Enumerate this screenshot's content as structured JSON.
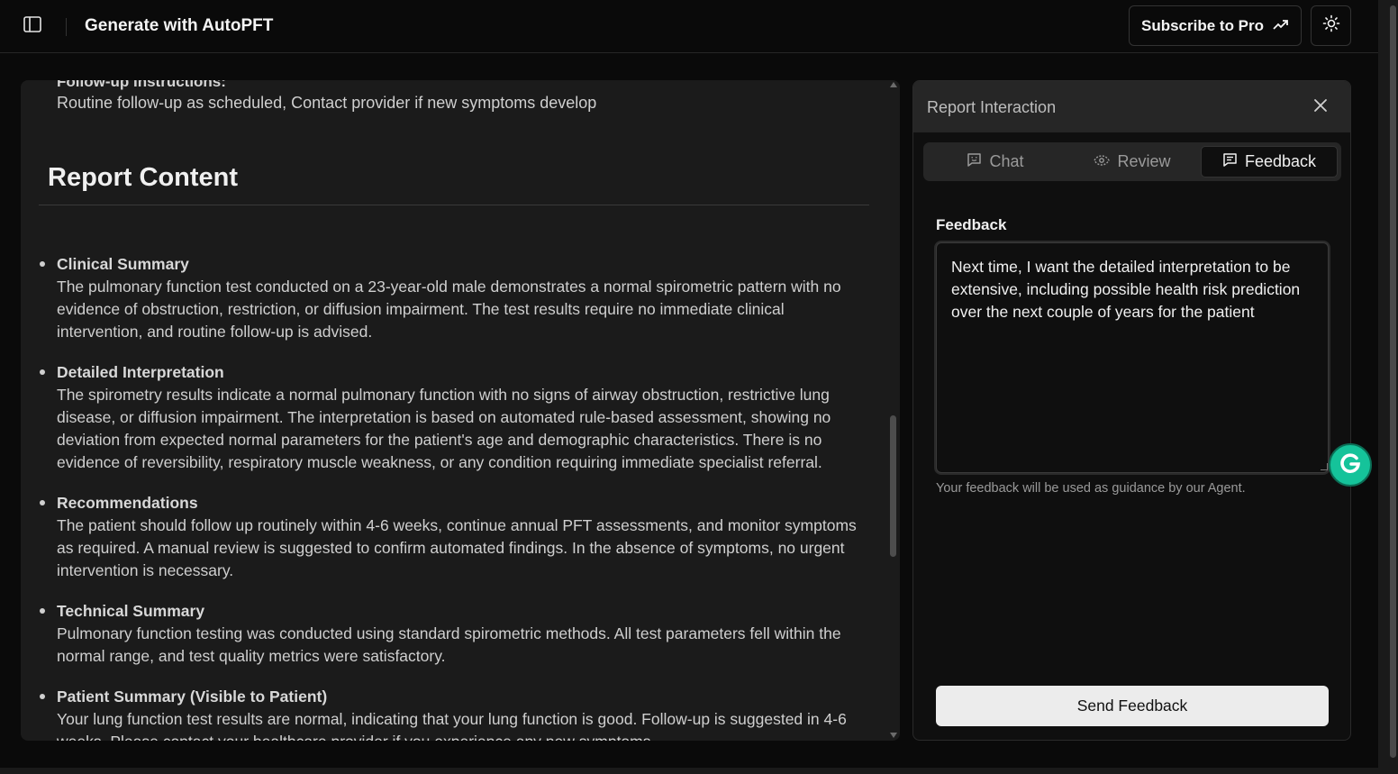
{
  "header": {
    "title": "Generate with AutoPFT",
    "subscribe_label": "Subscribe to Pro"
  },
  "icons": {
    "sidebar_toggle": "sidebar-panel-icon",
    "subscribe": "trending-up-arrow-icon",
    "theme": "sun-icon",
    "close": "close-icon",
    "chat": "message-square-icon",
    "review": "eye-scan-icon",
    "feedback": "message-square-text-icon",
    "grammarly": "grammarly-g-icon"
  },
  "report": {
    "followup_label": "Follow-up Instructions:",
    "followup_text": "Routine follow-up as scheduled, Contact provider if new symptoms develop",
    "heading": "Report Content",
    "sections": [
      {
        "title": "Clinical Summary",
        "body": "The pulmonary function test conducted on a 23-year-old male demonstrates a normal spirometric pattern with no evidence of obstruction, restriction, or diffusion impairment. The test results require no immediate clinical intervention, and routine follow-up is advised."
      },
      {
        "title": "Detailed Interpretation",
        "body": "The spirometry results indicate a normal pulmonary function with no signs of airway obstruction, restrictive lung disease, or diffusion impairment. The interpretation is based on automated rule-based assessment, showing no deviation from expected normal parameters for the patient's age and demographic characteristics. There is no evidence of reversibility, respiratory muscle weakness, or any condition requiring immediate specialist referral."
      },
      {
        "title": "Recommendations",
        "body": "The patient should follow up routinely within 4-6 weeks, continue annual PFT assessments, and monitor symptoms as required. A manual review is suggested to confirm automated findings. In the absence of symptoms, no urgent intervention is necessary."
      },
      {
        "title": "Technical Summary",
        "body": "Pulmonary function testing was conducted using standard spirometric methods. All test parameters fell within the normal range, and test quality metrics were satisfactory."
      },
      {
        "title": "Patient Summary (Visible to Patient)",
        "body": "Your lung function test results are normal, indicating that your lung function is good. Follow-up is suggested in 4-6 weeks. Please contact your healthcare provider if you experience any new symptoms."
      }
    ]
  },
  "interaction": {
    "title": "Report Interaction",
    "tabs": [
      {
        "label": "Chat",
        "active": false
      },
      {
        "label": "Review",
        "active": false
      },
      {
        "label": "Feedback",
        "active": true
      }
    ],
    "feedback_label": "Feedback",
    "feedback_value": "Next time, I want the detailed interpretation to be extensive, including possible health risk prediction over the next couple of years for the patient",
    "feedback_hint": "Your feedback will be used as guidance by our Agent.",
    "send_label": "Send Feedback"
  },
  "colors": {
    "background": "#0a0a0a",
    "panel": "#1b1b1b",
    "grammarly": "#15c39a",
    "send_button": "#ececec"
  }
}
